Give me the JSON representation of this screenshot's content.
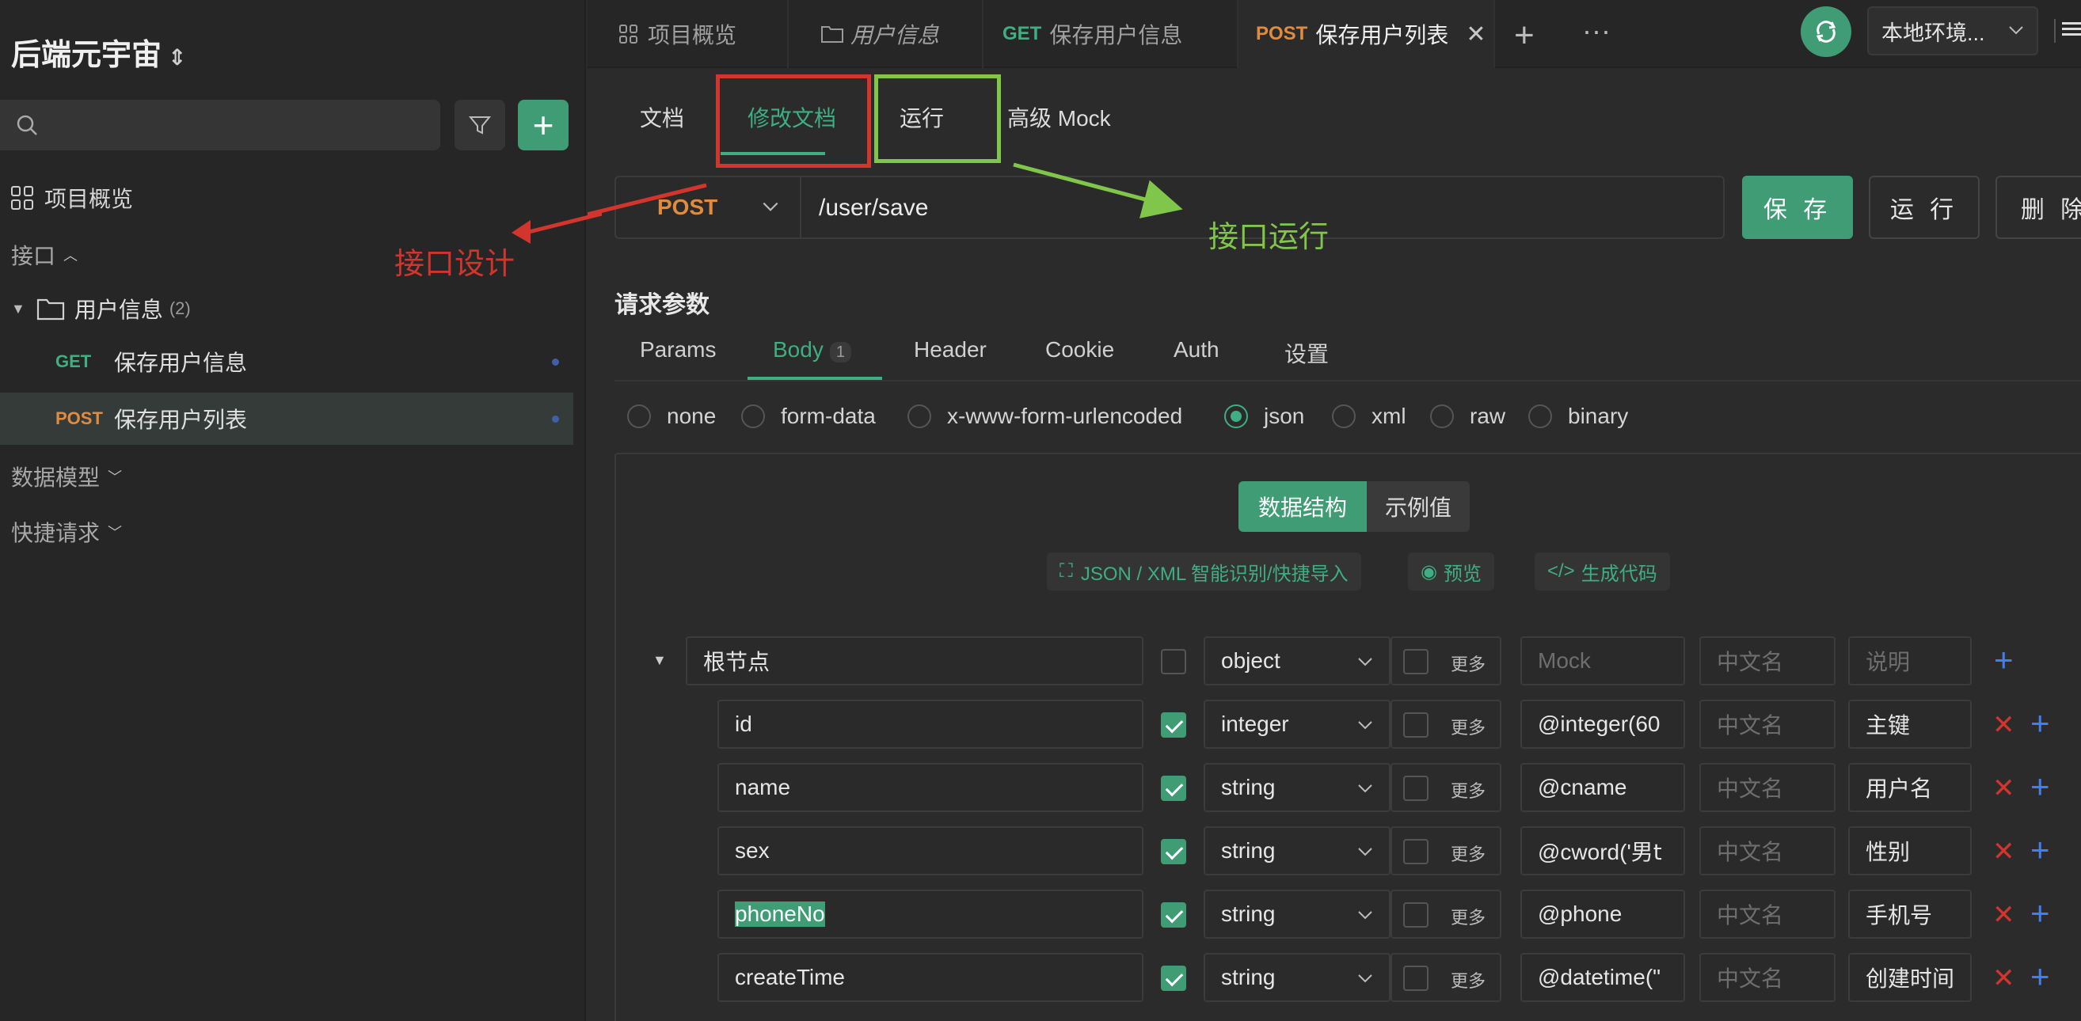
{
  "sidebar": {
    "project_title": "后端元宇宙",
    "project_chevron": "⌃⌄",
    "overview": "项目概览",
    "apis_label": "接口",
    "folder": {
      "name": "用户信息",
      "count": "(2)"
    },
    "items": [
      {
        "method": "GET",
        "name": "保存用户信息"
      },
      {
        "method": "POST",
        "name": "保存用户列表"
      }
    ],
    "data_models": "数据模型",
    "quick_requests": "快捷请求"
  },
  "tabs": [
    {
      "icon": "grid-icon",
      "label": "项目概览"
    },
    {
      "icon": "folder-icon",
      "label": "用户信息"
    },
    {
      "method": "GET",
      "label": "保存用户信息"
    },
    {
      "method": "POST",
      "label": "保存用户列表"
    }
  ],
  "tabbar": {
    "env": "本地环境..."
  },
  "doc_tabs": [
    "文档",
    "修改文档",
    "运行",
    "高级 Mock"
  ],
  "request": {
    "method": "POST",
    "url": "/user/save",
    "save": "保 存",
    "run": "运 行",
    "delete": "删 除"
  },
  "annotations": {
    "design": "接口设计",
    "run": "接口运行"
  },
  "params": {
    "title": "请求参数",
    "tabs": [
      "Params",
      "Body",
      "Header",
      "Cookie",
      "Auth",
      "设置"
    ],
    "body_count": "1",
    "body_types": [
      "none",
      "form-data",
      "x-www-form-urlencoded",
      "json",
      "xml",
      "raw",
      "binary"
    ],
    "selected_body_type": "json"
  },
  "editor": {
    "seg_structure": "数据结构",
    "seg_example": "示例值",
    "tool_import": "JSON / XML 智能识别/快捷导入",
    "tool_preview": "预览",
    "tool_codegen": "生成代码",
    "more_label": "更多",
    "cn_placeholder": "中文名",
    "desc_placeholder": "说明",
    "mock_placeholder": "Mock",
    "root": {
      "name": "根节点",
      "type": "object"
    },
    "fields": [
      {
        "name": "id",
        "type": "integer",
        "mock": "@integer(60",
        "desc": "主键"
      },
      {
        "name": "name",
        "type": "string",
        "mock": "@cname",
        "desc": "用户名"
      },
      {
        "name": "sex",
        "type": "string",
        "mock": "@cword('男𝗍",
        "desc": "性别"
      },
      {
        "name": "phoneNo",
        "type": "string",
        "mock": "@phone",
        "desc": "手机号"
      },
      {
        "name": "createTime",
        "type": "string",
        "mock": "@datetime(\"",
        "desc": "创建时间"
      }
    ]
  },
  "colors": {
    "accent": "#3f9c74",
    "post": "#e08c3f",
    "get": "#3fae82",
    "annot_red": "#d2352b",
    "annot_green": "#7fc64a"
  }
}
